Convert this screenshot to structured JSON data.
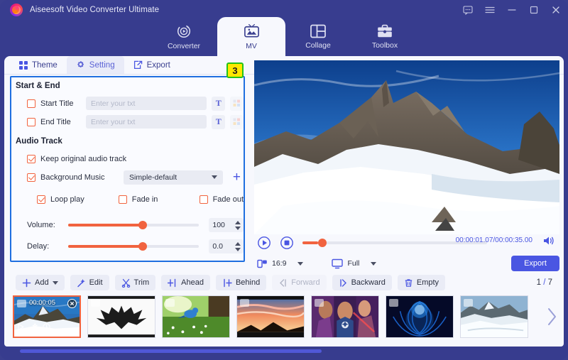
{
  "window": {
    "app_title": "Aiseesoft Video Converter Ultimate",
    "controls": [
      {
        "name": "feedback-icon",
        "label": "Feedback"
      },
      {
        "name": "menu-icon",
        "label": "Menu"
      },
      {
        "name": "minimize-icon",
        "label": "Minimize"
      },
      {
        "name": "maximize-icon",
        "label": "Maximize"
      },
      {
        "name": "close-icon",
        "label": "Close"
      }
    ]
  },
  "main_nav": {
    "items": [
      {
        "label": "Converter",
        "icon": "converter-icon",
        "active": false
      },
      {
        "label": "MV",
        "icon": "mv-icon",
        "active": true
      },
      {
        "label": "Collage",
        "icon": "collage-icon",
        "active": false
      },
      {
        "label": "Toolbox",
        "icon": "toolbox-icon",
        "active": false
      }
    ]
  },
  "sub_tabs": {
    "items": [
      {
        "label": "Theme",
        "icon": "grid-icon",
        "active": false
      },
      {
        "label": "Setting",
        "icon": "gear-icon",
        "active": true
      },
      {
        "label": "Export",
        "icon": "export-icon",
        "active": false
      }
    ]
  },
  "badge": {
    "text": "3",
    "bg": "#ffe800",
    "border": "#24c417"
  },
  "settings": {
    "start_end": {
      "section_title": "Start & End",
      "start_title": {
        "label": "Start Title",
        "checked": false,
        "value": "",
        "placeholder": "Enter your txt"
      },
      "end_title": {
        "label": "End Title",
        "checked": false,
        "value": "",
        "placeholder": "Enter your txt"
      },
      "text_button": "T",
      "style_button_name": "text-color-icon"
    },
    "audio_track": {
      "section_title": "Audio Track",
      "keep_original": {
        "label": "Keep original audio track",
        "checked": true
      },
      "background_music": {
        "label": "Background Music",
        "checked": true
      },
      "music_select": {
        "value": "Simple-default"
      },
      "add_music_button": "+",
      "loop_play": {
        "label": "Loop play",
        "checked": true
      },
      "fade_in": {
        "label": "Fade in",
        "checked": false
      },
      "fade_out": {
        "label": "Fade out",
        "checked": false
      },
      "volume": {
        "label": "Volume:",
        "value": "100",
        "percent": 57
      },
      "delay": {
        "label": "Delay:",
        "value": "0.0",
        "percent": 57
      }
    }
  },
  "preview": {
    "time_current": "00:00:01.07",
    "time_total": "00:00:35.00",
    "time_display": "00:00:01.07/00:00:35.00",
    "progress_percent": 8,
    "play_icon": "play-circle-icon",
    "stop_icon": "stop-circle-icon",
    "volume_icon": "speaker-icon",
    "aspect_ratio": "16:9",
    "screen_mode": "Full",
    "export_label": "Export",
    "accent": "#4a56e2"
  },
  "toolbar": {
    "buttons": [
      {
        "label": "Add",
        "icon": "plus-icon",
        "dropdown": true,
        "disabled": false
      },
      {
        "label": "Edit",
        "icon": "magic-wand-icon",
        "dropdown": false,
        "disabled": false
      },
      {
        "label": "Trim",
        "icon": "scissors-icon",
        "dropdown": false,
        "disabled": false
      },
      {
        "label": "Ahead",
        "icon": "insert-ahead-icon",
        "dropdown": false,
        "disabled": false
      },
      {
        "label": "Behind",
        "icon": "insert-behind-icon",
        "dropdown": false,
        "disabled": false
      },
      {
        "label": "Forward",
        "icon": "move-forward-icon",
        "dropdown": false,
        "disabled": true
      },
      {
        "label": "Backward",
        "icon": "move-backward-icon",
        "dropdown": false,
        "disabled": false
      },
      {
        "label": "Empty",
        "icon": "trash-icon",
        "dropdown": false,
        "disabled": false
      }
    ],
    "counter_current": "1",
    "counter_separator": "/",
    "counter_total": "7",
    "counter_text": "1 / 7"
  },
  "thumbnails": {
    "items": [
      {
        "name": "thumb-mountain",
        "duration": "00:00:05",
        "selected": true,
        "has_close": true,
        "has_tools": true
      },
      {
        "name": "thumb-batman",
        "duration": "",
        "selected": false,
        "has_close": false,
        "has_tools": false
      },
      {
        "name": "thumb-bird",
        "duration": "",
        "selected": false,
        "has_close": false,
        "has_tools": false
      },
      {
        "name": "thumb-sunset",
        "duration": "",
        "selected": false,
        "has_close": false,
        "has_tools": false
      },
      {
        "name": "thumb-avengers",
        "duration": "",
        "selected": false,
        "has_close": false,
        "has_tools": false
      },
      {
        "name": "thumb-blue-flower",
        "duration": "",
        "selected": false,
        "has_close": false,
        "has_tools": false
      },
      {
        "name": "thumb-snow-mountain",
        "duration": "",
        "selected": false,
        "has_close": false,
        "has_tools": false
      }
    ],
    "next_arrow_name": "next-page-arrow"
  },
  "colors": {
    "header_bg": "#383d8f",
    "panel_bg": "#f7f8fd",
    "accent_blue": "#4a56e2",
    "accent_orange": "#f1633f",
    "highlight_border": "#1f6fe0"
  }
}
